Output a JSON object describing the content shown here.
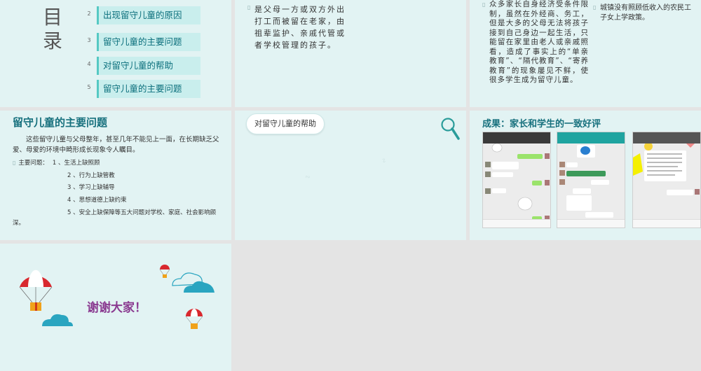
{
  "toc": {
    "title": "目录",
    "items": [
      {
        "num": "2",
        "label": "出现留守儿童的原因"
      },
      {
        "num": "3",
        "label": "留守儿童的主要问题"
      },
      {
        "num": "4",
        "label": "对留守儿童的帮助"
      },
      {
        "num": "5",
        "label": "留守儿童的主要问题"
      }
    ]
  },
  "slide2": {
    "bullet": "▯",
    "text": "是父母一方或双方外出打工而被留在老家，由祖辈监护、亲戚代管或者学校管理的孩子。"
  },
  "slide3": {
    "bullet": "▯",
    "text": "众多家长自身经济受条件限制，虽然在外经商、务工，但是大多的父母无法将孩子接到自己身边一起生活，只能留在家里由老人或亲戚照看，造成了事实上的“单亲教育”、“隔代教育”、“寄养教育”的现象屡见不鲜，使很多学生成为留守儿童。",
    "bullet2": "▯",
    "text2": "城镇没有照顾低收入的农民工子女上学政策。"
  },
  "slide4": {
    "title": "留守儿童的主要问题",
    "para": "这些留守儿童与父母整年，甚至几年不能见上一面，在长期缺乏父爱、母爱的环境中畸形成长现象令人瞩目。",
    "bullet": "▯",
    "list_label": "主要问题：",
    "items": [
      "1 、生活上缺照顾",
      "2 、行为上缺管教",
      "3 、学习上缺辅导",
      "4 、思想道德上缺约束",
      "5 、安全上缺保障等五大问题对学校、家庭、社会影响颇深。"
    ]
  },
  "slide5": {
    "pill": "对留守儿童的帮助"
  },
  "slide6": {
    "title": "成果：家长和学生的一致好评"
  },
  "slide7": {
    "thanks": "谢谢大家！"
  },
  "colors": {
    "slide_bg": "#e2f3f3",
    "accent": "#16707d",
    "toc_box": "#c9eeed",
    "toc_border": "#55c9c3",
    "thanks": "#8a3a90"
  }
}
